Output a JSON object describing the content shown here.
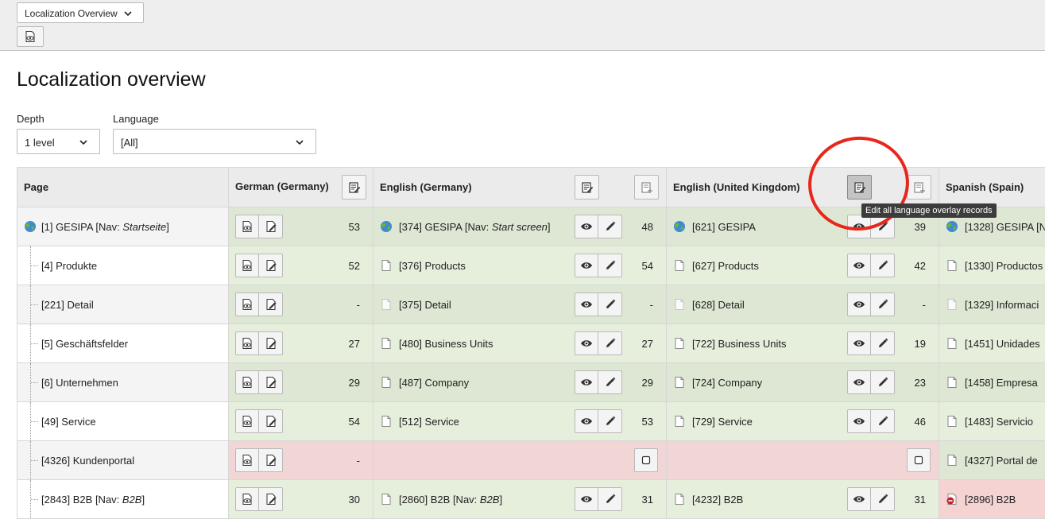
{
  "module_menu": {
    "selected": "Localization Overview"
  },
  "title": "Localization overview",
  "filters": {
    "depth_label": "Depth",
    "depth_value": "1 level",
    "language_label": "Language",
    "language_value": "[All]"
  },
  "table": {
    "headers": {
      "page": "Page",
      "de_de": "German (Germany)",
      "en_de": "English (Germany)",
      "en_gb": "English (United Kingdom)",
      "es_es": "Spanish (Spain)"
    },
    "tooltip": "Edit all language overlay records",
    "rows": [
      {
        "page": "[1] GESIPA [Nav: ",
        "page_nav": "Startseite",
        "page_tail": "]",
        "de_count": "53",
        "en_de": "[374] GESIPA [Nav: ",
        "en_de_nav": "Start screen",
        "en_de_tail": "]",
        "en_de_count": "48",
        "en_gb": "[621] GESIPA",
        "en_gb_count": "39",
        "es": "[1328] GESIPA [N"
      },
      {
        "page": "[4] Produkte",
        "de_count": "52",
        "en_de": "[376] Products",
        "en_de_count": "54",
        "en_gb": "[627] Products",
        "en_gb_count": "42",
        "es": "[1330] Productos"
      },
      {
        "page": "[221] Detail",
        "de_count": "-",
        "en_de": "[375] Detail",
        "en_de_count": "-",
        "en_gb": "[628] Detail",
        "en_gb_count": "-",
        "es": "[1329] Informaci"
      },
      {
        "page": "[5] Geschäftsfelder",
        "de_count": "27",
        "en_de": "[480] Business Units",
        "en_de_count": "27",
        "en_gb": "[722] Business Units",
        "en_gb_count": "19",
        "es": "[1451] Unidades"
      },
      {
        "page": "[6] Unternehmen",
        "de_count": "29",
        "en_de": "[487] Company",
        "en_de_count": "29",
        "en_gb": "[724] Company",
        "en_gb_count": "23",
        "es": "[1458] Empresa"
      },
      {
        "page": "[49] Service",
        "de_count": "54",
        "en_de": "[512] Service",
        "en_de_count": "53",
        "en_gb": "[729] Service",
        "en_gb_count": "46",
        "es": "[1483] Servicio"
      },
      {
        "page": "[4326] Kundenportal",
        "de_count": "-",
        "es": "[4327] Portal de"
      },
      {
        "page": "[2843] B2B [Nav: ",
        "page_nav": "B2B",
        "page_tail": "]",
        "de_count": "30",
        "en_de": "[2860] B2B [Nav: ",
        "en_de_nav": "B2B",
        "en_de_tail": "]",
        "en_de_count": "31",
        "en_gb": "[4232] B2B",
        "en_gb_count": "31",
        "es": "[2896] B2B"
      }
    ]
  },
  "colors": {
    "translated": "#e6efdc",
    "missing": "#f2d5d5",
    "highlight_circle": "#e8261b"
  },
  "icons": [
    "chevron-down-icon",
    "view-page-icon",
    "edit-page-icon",
    "edit-all-overlays-icon",
    "new-overlay-icon",
    "globe-icon",
    "page-icon",
    "eye-icon",
    "pencil-icon",
    "checkbox-icon",
    "hidden-page-icon"
  ]
}
